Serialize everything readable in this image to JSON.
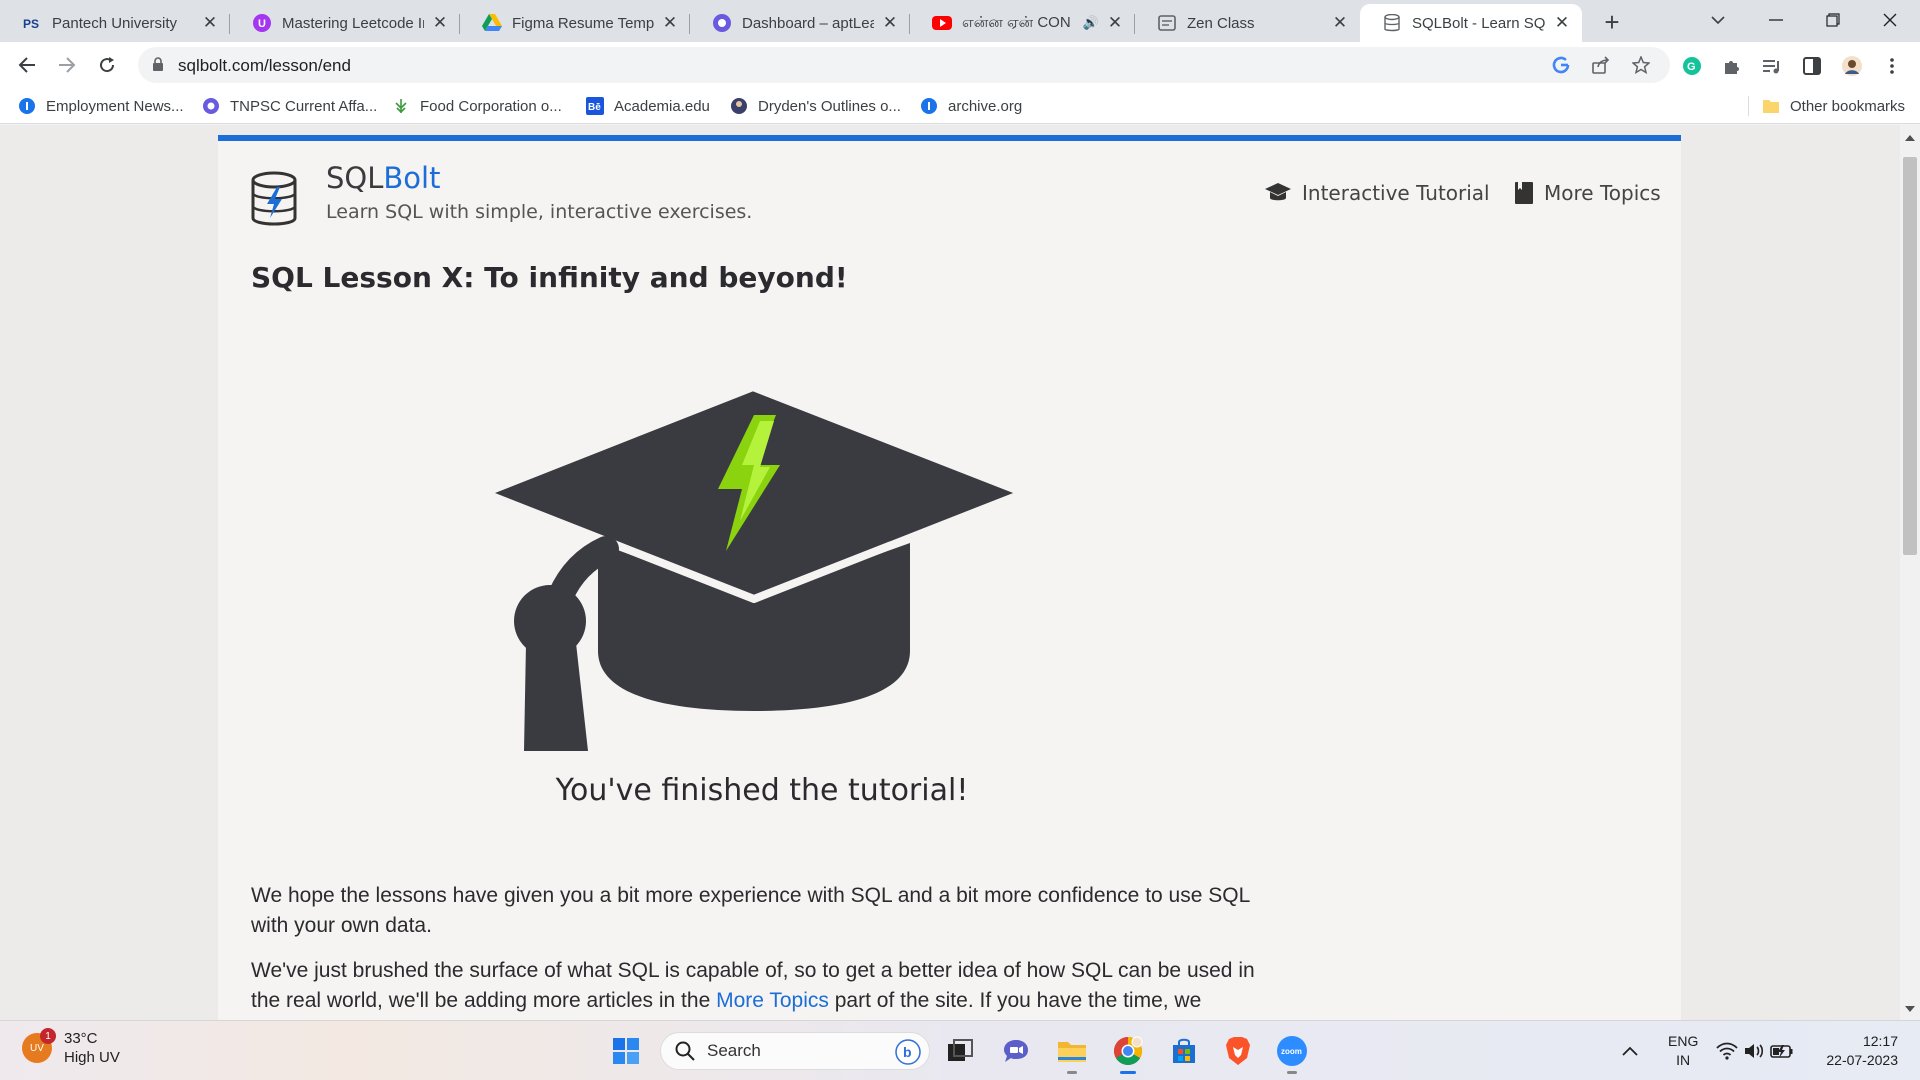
{
  "browser": {
    "tabs": [
      {
        "title": "Pantech University",
        "icon": "pantech-favicon",
        "active": false
      },
      {
        "title": "Mastering Leetcode In",
        "icon": "udemy-favicon",
        "active": false
      },
      {
        "title": "Figma Resume Templ",
        "icon": "google-drive-favicon",
        "active": false
      },
      {
        "title": "Dashboard – aptLearn",
        "icon": "aptlearn-favicon",
        "active": false
      },
      {
        "title": "என்ன ஏன் CON",
        "icon": "youtube-favicon",
        "active": false,
        "audio": true
      },
      {
        "title": "Zen Class",
        "icon": "zenclass-favicon",
        "active": false
      },
      {
        "title": "SQLBolt - Learn SQL -",
        "icon": "sqlbolt-favicon",
        "active": true
      }
    ],
    "url": "sqlbolt.com/lesson/end",
    "bookmarks": [
      {
        "label": "Employment News...",
        "icon": "globe-icon"
      },
      {
        "label": "TNPSC Current Affa...",
        "icon": "tnpsc-icon"
      },
      {
        "label": "Food Corporation o...",
        "icon": "fci-icon"
      },
      {
        "label": "Academia.edu",
        "icon": "academia-icon"
      },
      {
        "label": "Dryden's Outlines o...",
        "icon": "dryden-icon"
      },
      {
        "label": "archive.org",
        "icon": "globe-icon"
      }
    ],
    "other_bookmarks": "Other bookmarks"
  },
  "site": {
    "brand_plain": "SQL",
    "brand_accent": "Bolt",
    "tagline": "Learn SQL with simple, interactive exercises.",
    "nav": {
      "interactive_tutorial": "Interactive Tutorial",
      "more_topics": "More Topics"
    },
    "accent_color": "#1c6ed6"
  },
  "lesson": {
    "title": "SQL Lesson X: To infinity and beyond!",
    "finished": "You've finished the tutorial!",
    "para1": "We hope the lessons have given you a bit more experience with SQL and a bit more confidence to use SQL with your own data.",
    "para2_before": "We've just brushed the surface of what SQL is capable of, so to get a better idea of how SQL can be used in the real world, we'll be adding more articles in the ",
    "para2_link": "More Topics",
    "para2_after": " part of the site. If you have the time, we recommend that you continue to dive deeper into SQL!"
  },
  "taskbar": {
    "weather_temp": "33°C",
    "weather_desc": "High UV",
    "weather_badge": "1",
    "weather_icon_text": "UV",
    "search_label": "Search",
    "lang_line1": "ENG",
    "lang_line2": "IN",
    "time": "12:17",
    "date": "22-07-2023",
    "zoom_label": "zoom"
  }
}
